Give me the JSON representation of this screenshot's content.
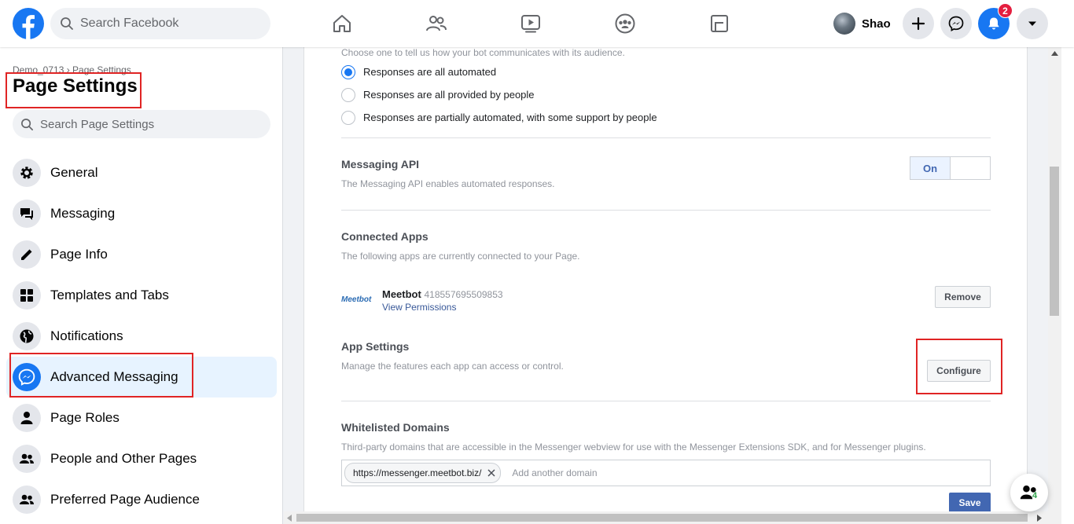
{
  "topbar": {
    "search_placeholder": "Search Facebook",
    "profile_name": "Shao",
    "notification_count": "2",
    "nav_icons": [
      "home-icon",
      "friends-icon",
      "watch-icon",
      "groups-icon",
      "gaming-icon"
    ],
    "brand_color": "#1877f2"
  },
  "sidebar": {
    "breadcrumb": "Demo_0713 › Page Settings",
    "title": "Page Settings",
    "search_placeholder": "Search Page Settings",
    "active_item": "Advanced Messaging",
    "items": [
      {
        "label": "General",
        "icon": "gear-icon"
      },
      {
        "label": "Messaging",
        "icon": "chat-bubbles-icon"
      },
      {
        "label": "Page Info",
        "icon": "pencil-icon"
      },
      {
        "label": "Templates and Tabs",
        "icon": "grid-icon"
      },
      {
        "label": "Notifications",
        "icon": "globe-icon"
      },
      {
        "label": "Advanced Messaging",
        "icon": "messenger-icon"
      },
      {
        "label": "Page Roles",
        "icon": "person-icon"
      },
      {
        "label": "People and Other Pages",
        "icon": "people-icon"
      },
      {
        "label": "Preferred Page Audience",
        "icon": "people-icon"
      }
    ]
  },
  "main": {
    "bot_prompt": "Choose one to tell us how your bot communicates with its audience.",
    "bot_options": [
      {
        "label": "Responses are all automated",
        "checked": true
      },
      {
        "label": "Responses are all provided by people",
        "checked": false
      },
      {
        "label": "Responses are partially automated, with some support by people",
        "checked": false
      }
    ],
    "messaging_api": {
      "title": "Messaging API",
      "desc": "The Messaging API enables automated responses.",
      "toggle_label": "On"
    },
    "connected_apps": {
      "title": "Connected Apps",
      "desc": "The following apps are currently connected to your Page.",
      "app_logo": "Meetbot",
      "app_name": "Meetbot",
      "app_id": "418557695509853",
      "permissions_link": "View Permissions",
      "remove_label": "Remove"
    },
    "app_settings": {
      "title": "App Settings",
      "desc": "Manage the features each app can access or control.",
      "configure_label": "Configure"
    },
    "whitelisted": {
      "title": "Whitelisted Domains",
      "desc": "Third-party domains that are accessible in the Messenger webview for use with the Messenger Extensions SDK, and for Messenger plugins.",
      "domain": "https://messenger.meetbot.biz/",
      "placeholder": "Add another domain",
      "save_label": "Save"
    }
  },
  "floating": {
    "count": "4"
  }
}
